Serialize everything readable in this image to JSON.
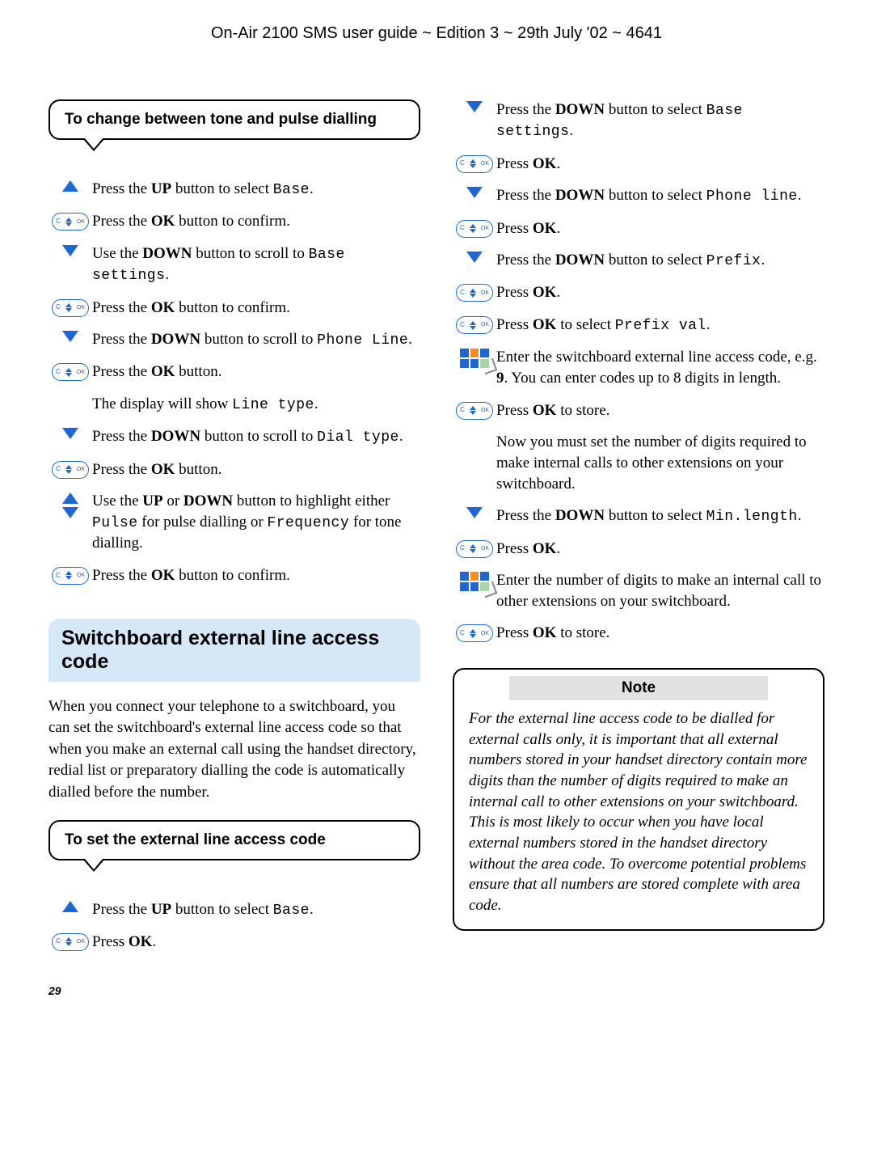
{
  "header": "On-Air 2100 SMS user guide ~ Edition 3 ~ 29th July '02 ~ 4641",
  "page_number": "29",
  "left": {
    "callout1_title": "To change between tone and pulse dialling",
    "steps1": [
      {
        "icon": "up",
        "pre": "Press the ",
        "b1": "UP",
        "mid": " button to select ",
        "mono": "Base",
        "post": "."
      },
      {
        "icon": "ok",
        "pre": "Press the ",
        "b1": "OK",
        "mid": " button to confirm.",
        "mono": "",
        "post": ""
      },
      {
        "icon": "down",
        "pre": "Use the ",
        "b1": "DOWN",
        "mid": " button to scroll to ",
        "mono": "Base settings",
        "post": "."
      },
      {
        "icon": "ok",
        "pre": "Press the ",
        "b1": "OK",
        "mid": " button to confirm.",
        "mono": "",
        "post": ""
      },
      {
        "icon": "down",
        "pre": "Press the ",
        "b1": "DOWN",
        "mid": " button to scroll to ",
        "mono": "Phone Line",
        "post": "."
      },
      {
        "icon": "ok",
        "pre": "Press the ",
        "b1": "OK",
        "mid": " button.",
        "mono": "",
        "post": ""
      },
      {
        "icon": "none",
        "pre": "The display will show ",
        "b1": "",
        "mid": "",
        "mono": "Line type",
        "post": "."
      },
      {
        "icon": "down",
        "pre": "Press the ",
        "b1": "DOWN",
        "mid": " button to scroll to ",
        "mono": "Dial type",
        "post": "."
      },
      {
        "icon": "ok",
        "pre": "Press the ",
        "b1": "OK",
        "mid": " button.",
        "mono": "",
        "post": ""
      },
      {
        "icon": "updown",
        "pre": "Use the ",
        "b1": "UP",
        "mid": " or ",
        "b2": "DOWN",
        "mid2": " button to highlight either ",
        "mono": "Pulse",
        "post": " for pulse dialling or ",
        "mono2": "Frequency",
        "post2": " for tone dialling."
      },
      {
        "icon": "ok",
        "pre": "Press the ",
        "b1": "OK",
        "mid": " button to confirm.",
        "mono": "",
        "post": ""
      }
    ],
    "section_heading": "Switchboard external line access code",
    "section_body": "When you connect your telephone to a switchboard, you can set the switchboard's external line access code so that when you make an external call using the handset directory, redial list or preparatory dialling the code is automatically dialled before the number.",
    "callout2_title": "To set the external line access code",
    "steps2": [
      {
        "icon": "up",
        "pre": "Press the ",
        "b1": "UP",
        "mid": " button to select ",
        "mono": "Base",
        "post": "."
      },
      {
        "icon": "ok",
        "pre": "Press ",
        "b1": "OK",
        "mid": ".",
        "mono": "",
        "post": ""
      }
    ]
  },
  "right": {
    "steps": [
      {
        "icon": "down",
        "pre": "Press the ",
        "b1": "DOWN",
        "mid": " button to select ",
        "mono": "Base settings",
        "post": "."
      },
      {
        "icon": "ok",
        "pre": "Press ",
        "b1": "OK",
        "mid": ".",
        "mono": "",
        "post": ""
      },
      {
        "icon": "down",
        "pre": "Press the ",
        "b1": "DOWN",
        "mid": " button to select ",
        "mono": "Phone line",
        "post": "."
      },
      {
        "icon": "ok",
        "pre": "Press ",
        "b1": "OK",
        "mid": ".",
        "mono": "",
        "post": ""
      },
      {
        "icon": "down",
        "pre": "Press the ",
        "b1": "DOWN",
        "mid": " button to select ",
        "mono": "Prefix",
        "post": "."
      },
      {
        "icon": "ok",
        "pre": "Press ",
        "b1": "OK",
        "mid": ".",
        "mono": "",
        "post": ""
      },
      {
        "icon": "ok",
        "pre": "Press ",
        "b1": "OK",
        "mid": " to select ",
        "mono": "Prefix val",
        "post": "."
      },
      {
        "icon": "keypad",
        "pre": "Enter the switchboard external line access code, e.g. ",
        "b1": "9",
        "mid": ". You can enter codes up to 8 digits in length.",
        "mono": "",
        "post": ""
      },
      {
        "icon": "ok",
        "pre": "Press ",
        "b1": "OK",
        "mid": " to store.",
        "mono": "",
        "post": ""
      },
      {
        "icon": "none",
        "pre": "Now you must set the number of digits required to make internal calls to other extensions on your switchboard.",
        "b1": "",
        "mid": "",
        "mono": "",
        "post": ""
      },
      {
        "icon": "down",
        "pre": "Press the ",
        "b1": "DOWN",
        "mid": " button to select ",
        "mono": "Min.length",
        "post": "."
      },
      {
        "icon": "ok",
        "pre": "Press ",
        "b1": "OK",
        "mid": ".",
        "mono": "",
        "post": ""
      },
      {
        "icon": "keypad",
        "pre": "Enter the number of digits to make an internal call to other extensions on your switchboard.",
        "b1": "",
        "mid": "",
        "mono": "",
        "post": ""
      },
      {
        "icon": "ok",
        "pre": "Press ",
        "b1": "OK",
        "mid": " to store.",
        "mono": "",
        "post": ""
      }
    ],
    "note_title": "Note",
    "note_body": "For the external line access code to be dialled for external calls only, it is important that all external numbers stored in your handset directory contain more digits than the number of digits required to make an internal call to other extensions on your switchboard. This is most likely to occur when you have local external numbers stored in the handset directory without the area code. To overcome potential problems ensure that all numbers are stored complete with area code."
  }
}
